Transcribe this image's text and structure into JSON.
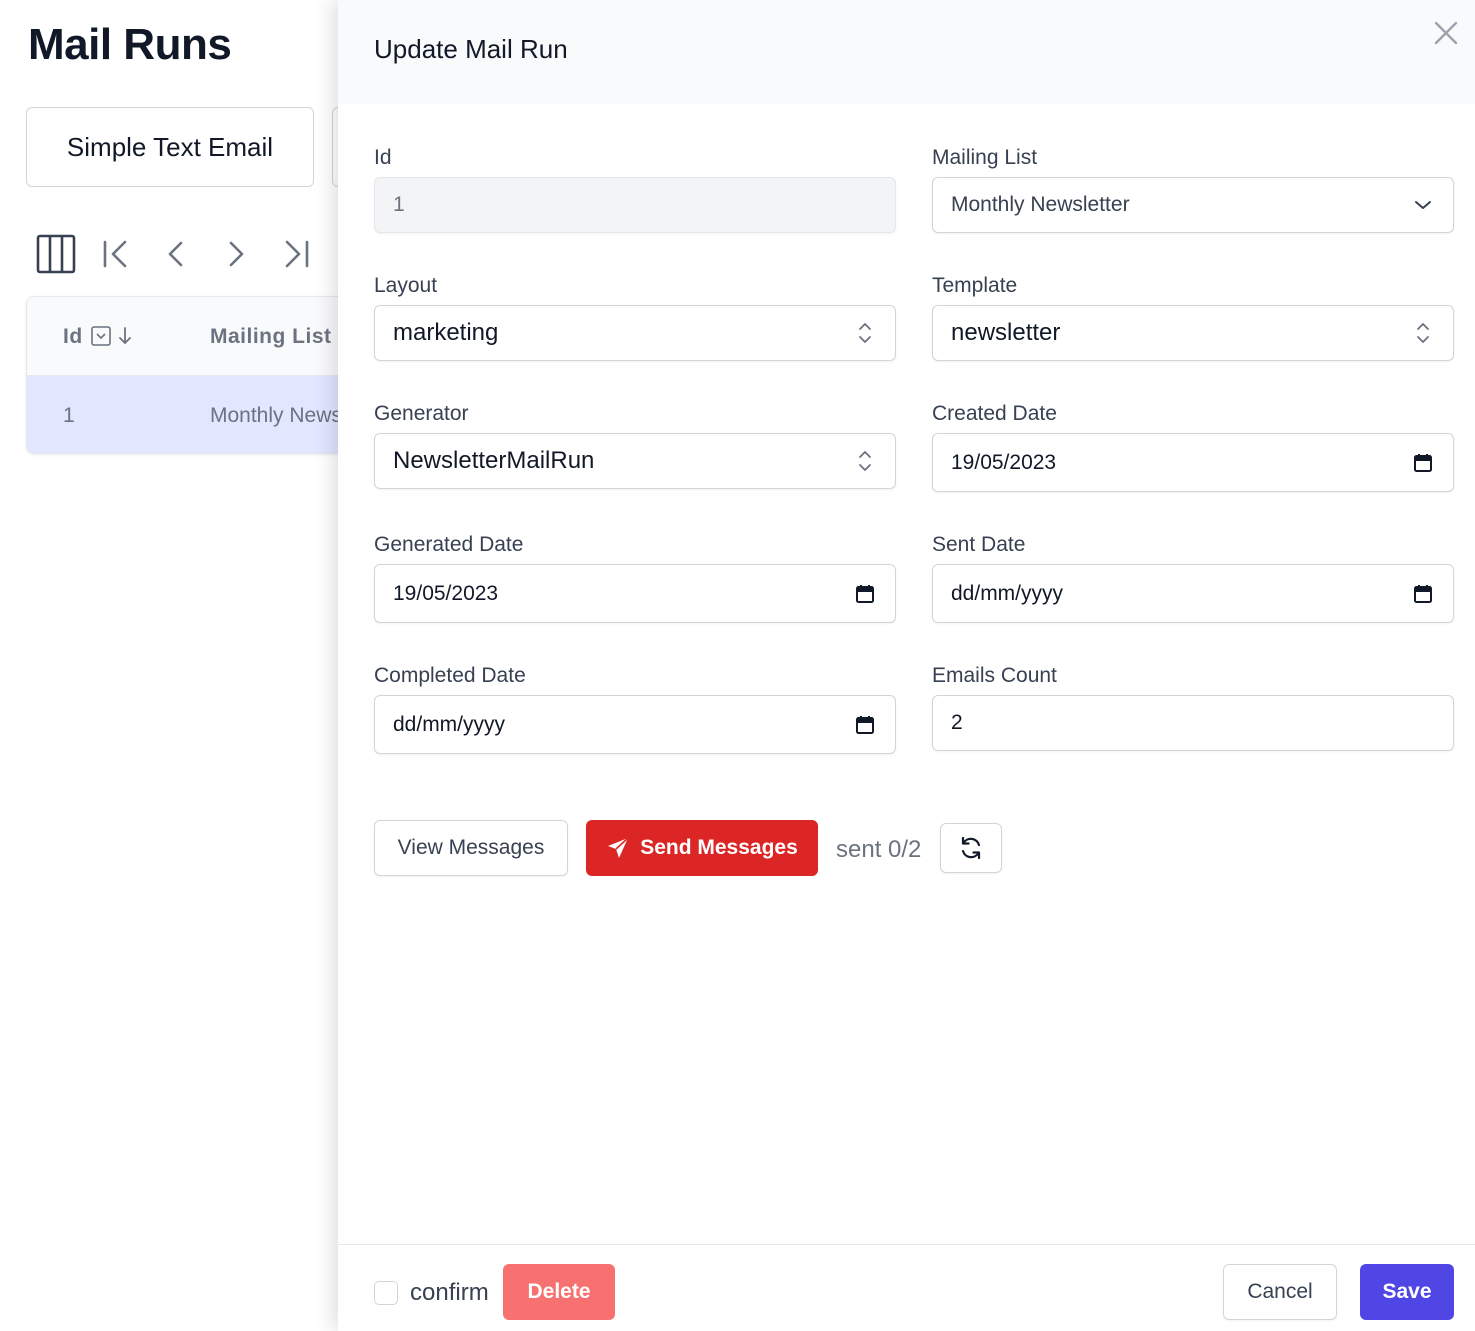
{
  "page": {
    "title": "Mail Runs",
    "tabs": [
      "Simple Text Email",
      ""
    ],
    "toolbar": {
      "columns_icon": "columns-icon",
      "first_icon": "first-page-icon",
      "prev_icon": "prev-page-icon",
      "next_icon": "next-page-icon",
      "last_icon": "last-page-icon"
    },
    "grid": {
      "columns": [
        "Id",
        "Mailing List"
      ],
      "rows": [
        {
          "id": "1",
          "mailing_list": "Monthly News"
        }
      ]
    }
  },
  "modal": {
    "title": "Update Mail Run",
    "fields": {
      "id": {
        "label": "Id",
        "value": "1"
      },
      "mailing_list": {
        "label": "Mailing List",
        "value": "Monthly Newsletter"
      },
      "layout": {
        "label": "Layout",
        "value": "marketing"
      },
      "template": {
        "label": "Template",
        "value": "newsletter"
      },
      "generator": {
        "label": "Generator",
        "value": "NewsletterMailRun"
      },
      "created_date": {
        "label": "Created Date",
        "value": "19/05/2023"
      },
      "generated_date": {
        "label": "Generated Date",
        "value": "19/05/2023"
      },
      "sent_date": {
        "label": "Sent Date",
        "value": "dd/mm/yyyy"
      },
      "completed_date": {
        "label": "Completed Date",
        "value": "dd/mm/yyyy"
      },
      "emails_count": {
        "label": "Emails Count",
        "value": "2"
      }
    },
    "actions": {
      "view_messages": "View Messages",
      "send_messages": "Send Messages",
      "sent_status": "sent 0/2"
    },
    "footer": {
      "confirm_label": "confirm",
      "delete": "Delete",
      "cancel": "Cancel",
      "save": "Save"
    },
    "colors": {
      "send": "#dc2626",
      "delete": "#f87171",
      "save": "#4f46e5",
      "selected_row": "#e0e7ff"
    }
  }
}
